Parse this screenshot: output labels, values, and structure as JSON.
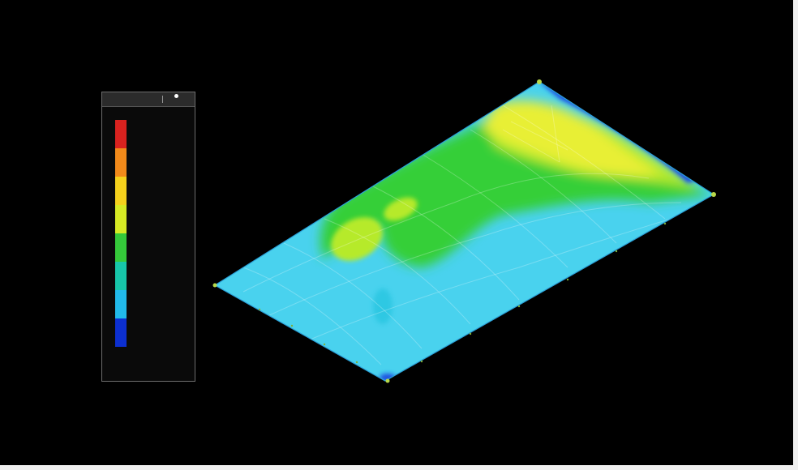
{
  "legend": {
    "title": "",
    "colors": [
      "#d9221f",
      "#f28a1a",
      "#f5d11c",
      "#d6ea24",
      "#35c93a",
      "#17c6a9",
      "#21b9ea",
      "#0c2fd0"
    ],
    "tick_labels": [
      "",
      "",
      "",
      "",
      "",
      "",
      "",
      "",
      "",
      ""
    ]
  },
  "plot": {
    "colors": {
      "light_blue": "#49d2ee",
      "cyan": "#2ec8e3",
      "green": "#35cf38",
      "yellow_green": "#b6ea2a",
      "yellow": "#e8ef36",
      "blue": "#1c4ee0"
    }
  }
}
